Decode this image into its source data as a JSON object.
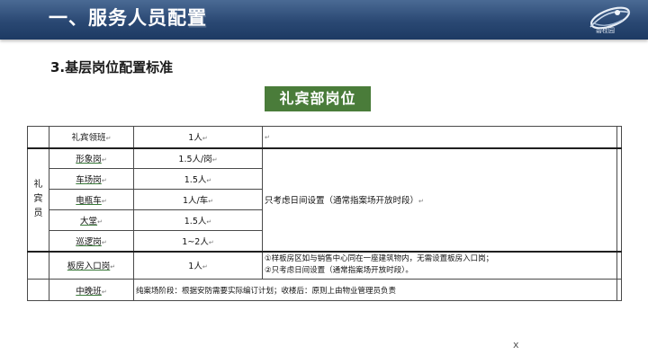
{
  "header": {
    "title": "一、服务人员配置",
    "shadow_text": "置",
    "logo_text": "碧桂园"
  },
  "subtitle": "3.基层岗位配置标准",
  "dept_badge": "礼宾部岗位",
  "table": {
    "merged_label": "礼宾员",
    "rows": [
      {
        "post": "礼宾领班",
        "staffing": "1人",
        "note": ""
      },
      {
        "post": "形象岗",
        "staffing": "1.5人/岗",
        "note": "只考虑日间设置（通常指案场开放时段）"
      },
      {
        "post": "车场岗",
        "staffing": "1.5人"
      },
      {
        "post": "电瓶车",
        "staffing": "1人/车"
      },
      {
        "post": "大堂",
        "staffing": "1.5人"
      },
      {
        "post": "巡逻岗",
        "staffing": "1~2人"
      },
      {
        "post": "板房入口岗",
        "staffing": "1人",
        "note_lines": [
          "①样板房区如与销售中心同在一座建筑物内，无需设置板房入口岗；",
          "②只考虑日间设置（通常指案场开放时段）。"
        ]
      },
      {
        "post": "中晚班",
        "staffing_note": "纯案场阶段：根据安防需要实际编订计划；收楼后：原则上由物业管理员负责"
      }
    ],
    "cell_mark": "↵"
  },
  "footer_mark": "x"
}
